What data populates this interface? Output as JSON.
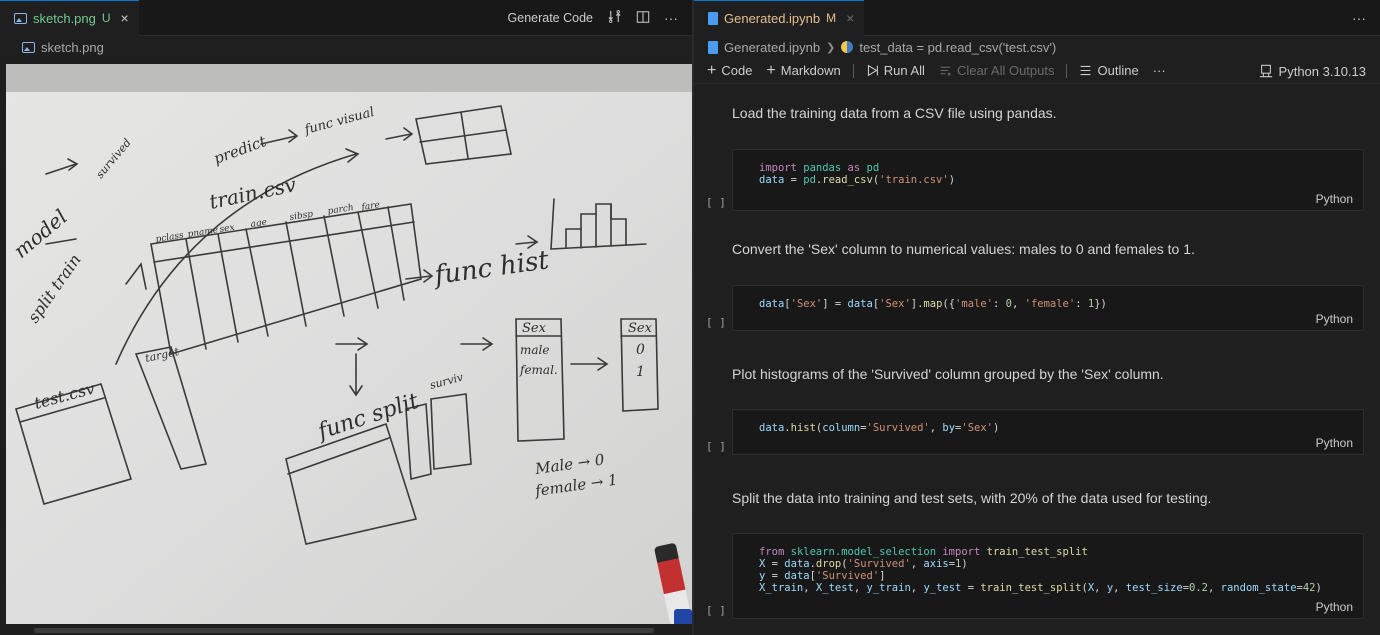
{
  "left_editor": {
    "tab": {
      "filename": "sketch.png",
      "status": "U",
      "close": "×"
    },
    "actions": {
      "generate_code": "Generate Code"
    },
    "breadcrumb": "sketch.png"
  },
  "right_editor": {
    "tab": {
      "filename": "Generated.ipynb",
      "status": "M",
      "close": "×"
    },
    "breadcrumb": {
      "file": "Generated.ipynb",
      "symbol": "test_data = pd.read_csv('test.csv')"
    },
    "toolbar": {
      "code": "Code",
      "markdown": "Markdown",
      "run_all": "Run All",
      "clear_outputs": "Clear All Outputs",
      "outline": "Outline",
      "more": "···",
      "kernel": "Python 3.10.13"
    },
    "cells": [
      {
        "markdown": "Load the training data from a CSV file using pandas.",
        "bracket": "[ ]",
        "language": "Python"
      },
      {
        "markdown": "Convert the 'Sex' column to numerical values: males to 0 and females to 1.",
        "bracket": "[ ]",
        "language": "Python"
      },
      {
        "markdown": "Plot histograms of the 'Survived' column grouped by the 'Sex' column.",
        "bracket": "[ ]",
        "language": "Python"
      },
      {
        "markdown": "Split the data into training and test sets, with 20% of the data used for testing.",
        "bracket": "[ ]",
        "language": "Python"
      }
    ]
  },
  "icons": {
    "image_file": "image-icon",
    "notebook_file": "notebook-icon",
    "python_symbol": "python-icon",
    "kernel": "kernel-icon"
  },
  "whiteboard_text": {
    "train_csv": "train.csv",
    "func_hist": "func hist",
    "sex_header": "Sex",
    "male": "male",
    "femal": "femal.",
    "sex_header_2": "Sex",
    "zero": "0",
    "one": "1",
    "mapping_1": "Male → 0",
    "mapping_2": "female → 1",
    "predict": "predict",
    "func_visual": "func visual",
    "model": "model",
    "split_train": "split train",
    "test_csv": "test.csv",
    "target": "target",
    "survived": "survived",
    "func_split": "func split",
    "survival": "surviv",
    "col_headers": [
      "pclass",
      "pname",
      "sex",
      "age",
      "sibsp",
      "parch",
      "fare"
    ]
  }
}
